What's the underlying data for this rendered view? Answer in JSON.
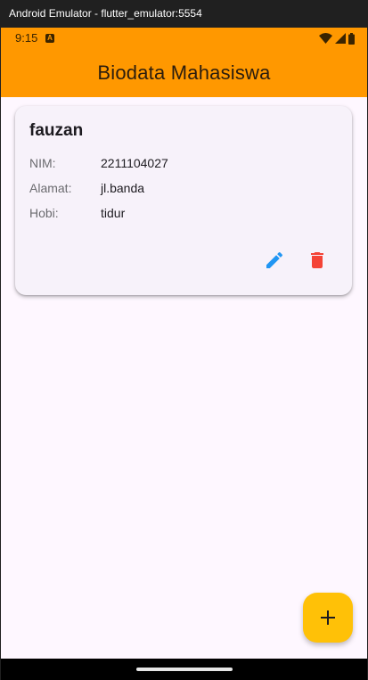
{
  "window": {
    "title": "Android Emulator - flutter_emulator:5554"
  },
  "status_bar": {
    "time": "9:15",
    "notification_icon": "a-badge-icon",
    "icons": [
      "wifi-icon",
      "signal-icon",
      "battery-icon"
    ]
  },
  "app_bar": {
    "title": "Biodata Mahasiswa",
    "color": "#ff9800"
  },
  "students": [
    {
      "name": "fauzan",
      "fields": [
        {
          "label": "NIM:",
          "value": "2211104027"
        },
        {
          "label": "Alamat:",
          "value": "jl.banda"
        },
        {
          "label": "Hobi:",
          "value": "tidur"
        }
      ],
      "actions": {
        "edit_icon": "pencil-icon",
        "edit_color": "#2196f3",
        "delete_icon": "trash-icon",
        "delete_color": "#f44336"
      }
    }
  ],
  "fab": {
    "icon": "plus-icon",
    "color": "#ffc107"
  }
}
